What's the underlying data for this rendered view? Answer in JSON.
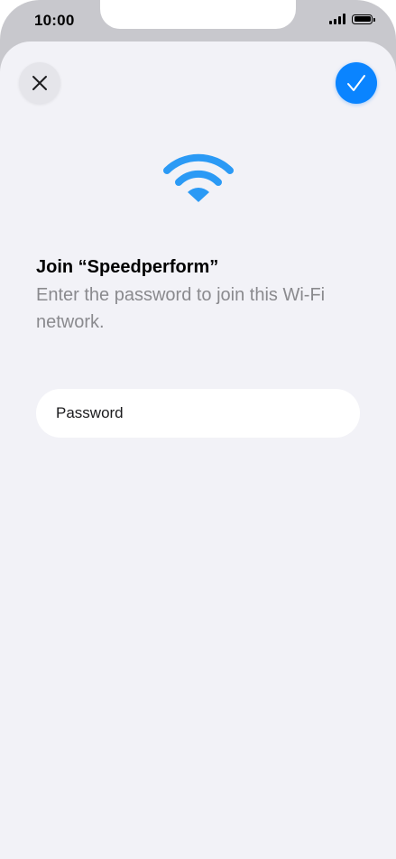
{
  "status_bar": {
    "time": "10:00",
    "icons": [
      "cellular-signal-icon",
      "battery-icon"
    ]
  },
  "sheet": {
    "close_icon": "close-icon",
    "confirm_icon": "checkmark-icon",
    "wifi_icon": "wifi-icon",
    "title": "Join “Speedperform”",
    "subtitle": "Enter the password to join this Wi-Fi network.",
    "password": {
      "placeholder": "Password",
      "value": ""
    }
  },
  "colors": {
    "accent": "#0a84ff",
    "wifi": "#2b9af5",
    "sheet_background": "#f2f2f7",
    "secondary_text": "#8a8a8e"
  }
}
